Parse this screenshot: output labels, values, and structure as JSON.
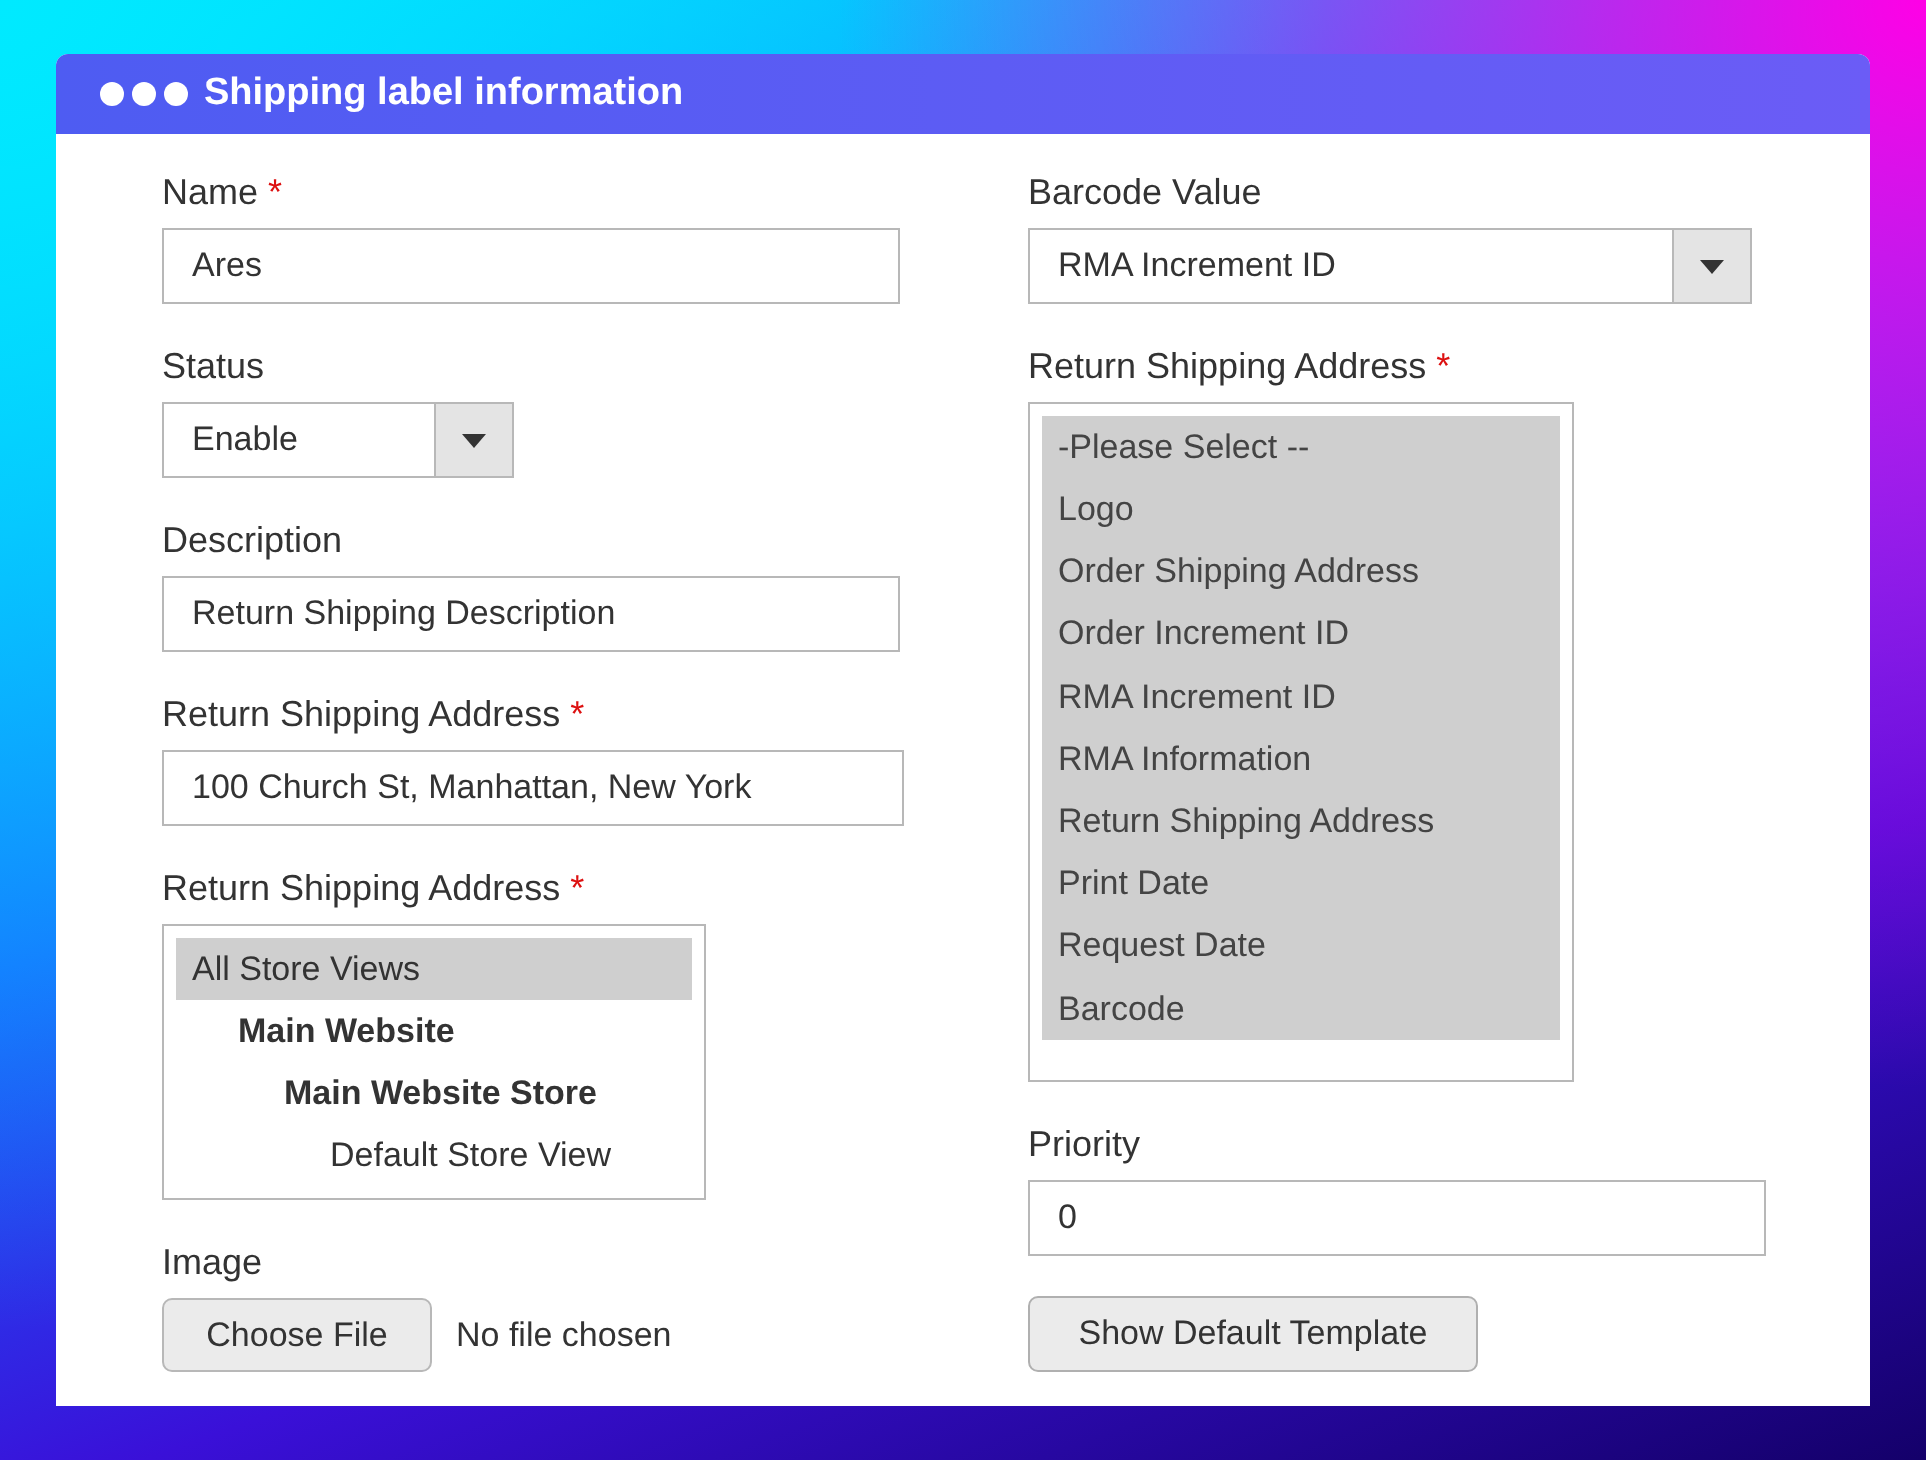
{
  "window": {
    "title": "Shipping label information"
  },
  "left_fields": [
    {
      "kind": "text",
      "label": "Name",
      "required_mark": "*",
      "value": "Ares"
    },
    {
      "kind": "select",
      "label": "Status",
      "value": "Enable"
    },
    {
      "kind": "text",
      "label": "Description",
      "value": "Return Shipping Description"
    },
    {
      "kind": "text",
      "label": "Return Shipping Address",
      "required_mark": "*",
      "value": "100 Church St, Manhattan, New York"
    },
    {
      "kind": "tree",
      "label": "Return Shipping Address",
      "required_mark": "*",
      "items": [
        {
          "label": "All Store Views",
          "kind": "option",
          "selected": true,
          "children": [
            {
              "label": "Main Website",
              "kind": "group",
              "selected": false,
              "children": [
                {
                  "label": "Main Website Store",
                  "kind": "group",
                  "selected": false,
                  "children": [
                    {
                      "label": "Default Store View",
                      "kind": "option",
                      "selected": false
                    }
                  ]
                }
              ]
            }
          ]
        }
      ]
    },
    {
      "kind": "file",
      "label": "Image",
      "button": "Choose File",
      "status": "No file chosen"
    }
  ],
  "right_fields": [
    {
      "kind": "select",
      "label": "Barcode Value",
      "value": "RMA Increment ID"
    },
    {
      "kind": "list",
      "label": "Return Shipping Address",
      "required_mark": "*",
      "items": [
        {
          "label": "-Please Select --",
          "selected": true
        },
        {
          "label": "Logo",
          "selected": true
        },
        {
          "label": "Order Shipping Address",
          "selected": true
        },
        {
          "label": "Order Increment ID",
          "selected": true
        },
        {
          "label": "RMA Increment ID",
          "selected": true
        },
        {
          "label": "RMA Information",
          "selected": true
        },
        {
          "label": "Return Shipping Address",
          "selected": true
        },
        {
          "label": "Print Date",
          "selected": true
        },
        {
          "label": "Request Date",
          "selected": true
        },
        {
          "label": "Barcode",
          "selected": true
        }
      ]
    },
    {
      "kind": "text",
      "label": "Priority",
      "value": "0"
    },
    {
      "kind": "button",
      "label": "Show Default Template"
    }
  ]
}
